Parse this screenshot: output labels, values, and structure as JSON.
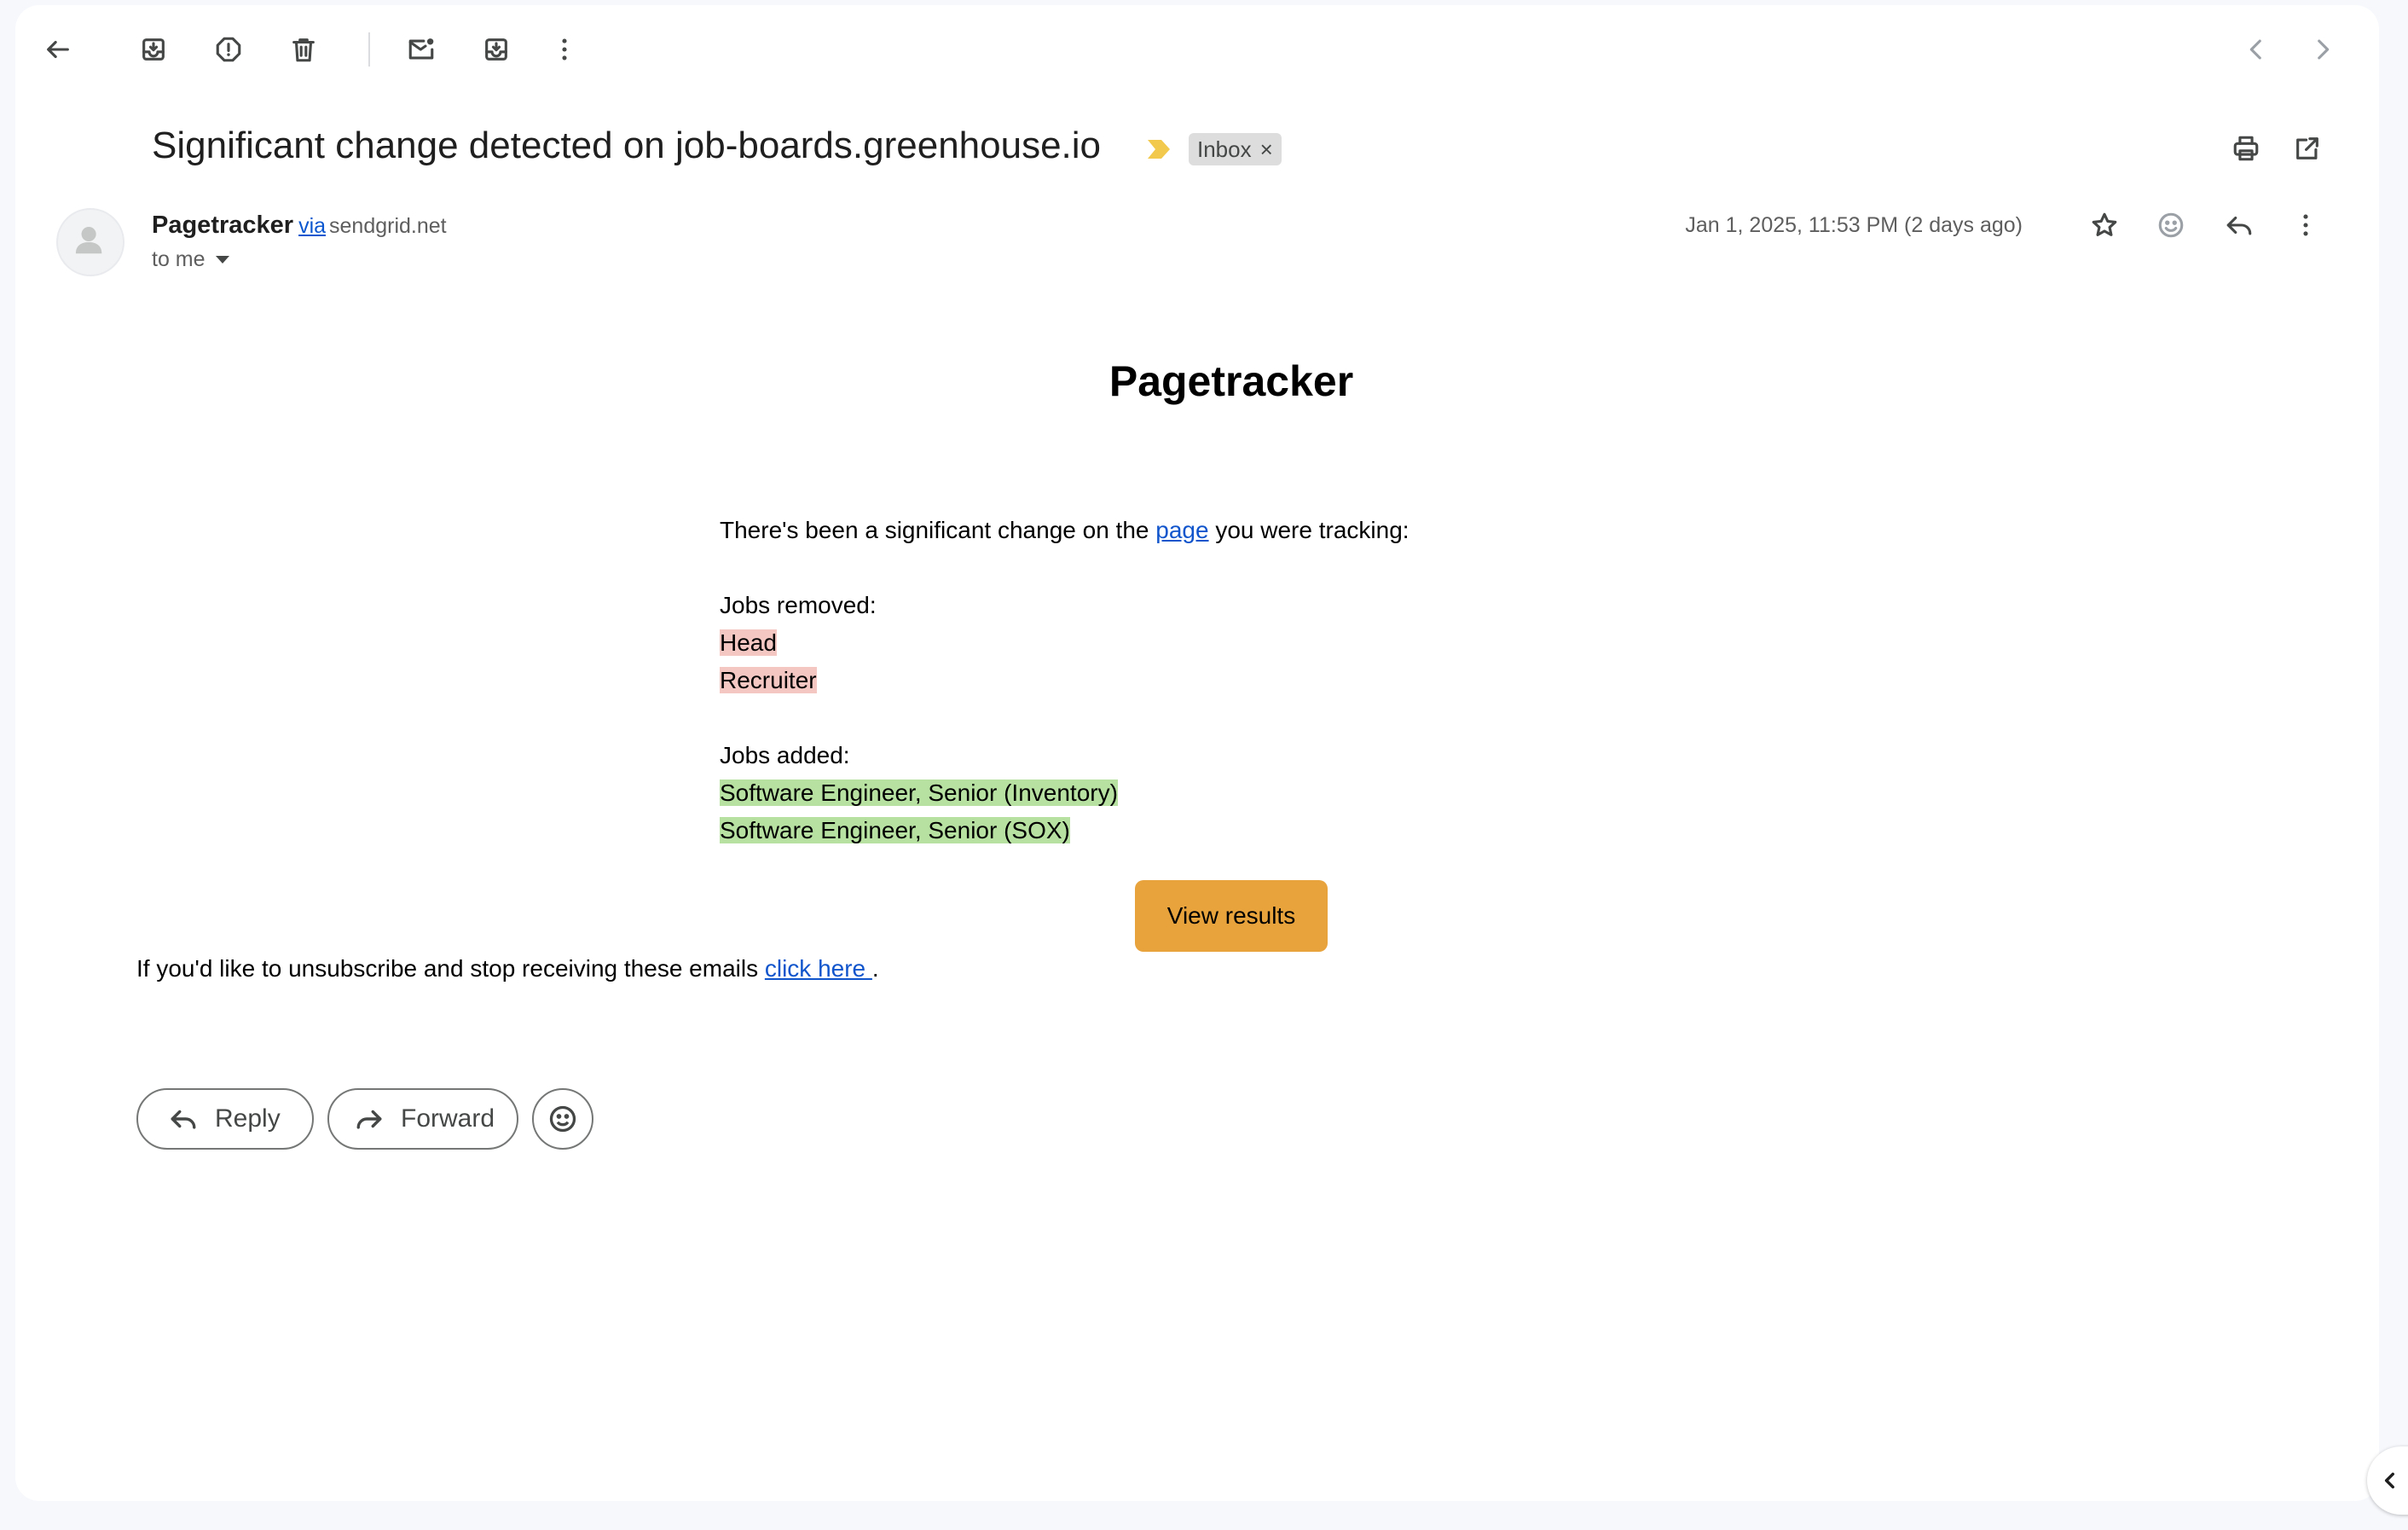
{
  "toolbar": {
    "icons": [
      "back-arrow-icon",
      "archive-icon",
      "report-spam-icon",
      "delete-icon",
      "mark-unread-icon",
      "move-to-icon",
      "more-vert-icon"
    ],
    "nav_icons": [
      "chevron-left-icon",
      "chevron-right-icon"
    ]
  },
  "email": {
    "subject": "Significant change detected on job-boards.greenhouse.io",
    "importance_color": "#f2c94c",
    "label": "Inbox",
    "label_remove": "×",
    "sender_name": "Pagetracker",
    "via_text": "via",
    "via_domain": "sendgrid.net",
    "to": "to me",
    "date": "Jan 1, 2025, 11:53 PM (2 days ago)",
    "header_icons": [
      "print-icon",
      "open-in-new-icon",
      "star-icon",
      "emoji-icon",
      "reply-icon",
      "more-vert-icon"
    ]
  },
  "body": {
    "title": "Pagetracker",
    "intro_before": "There's been a significant change on the ",
    "intro_link": "page",
    "intro_after": " you were tracking:",
    "removed_heading": "Jobs removed:",
    "removed": [
      "Head",
      "Recruiter"
    ],
    "added_heading": "Jobs added:",
    "added": [
      "Software Engineer, Senior (Inventory)",
      "Software Engineer, Senior (SOX)"
    ],
    "button": "View results",
    "button_color": "#e8a33d",
    "unsub_text": "If you'd like to unsubscribe and stop receiving these emails ",
    "unsub_link": "click here ",
    "unsub_end": "."
  },
  "actions": {
    "reply": "Reply",
    "forward": "Forward"
  }
}
